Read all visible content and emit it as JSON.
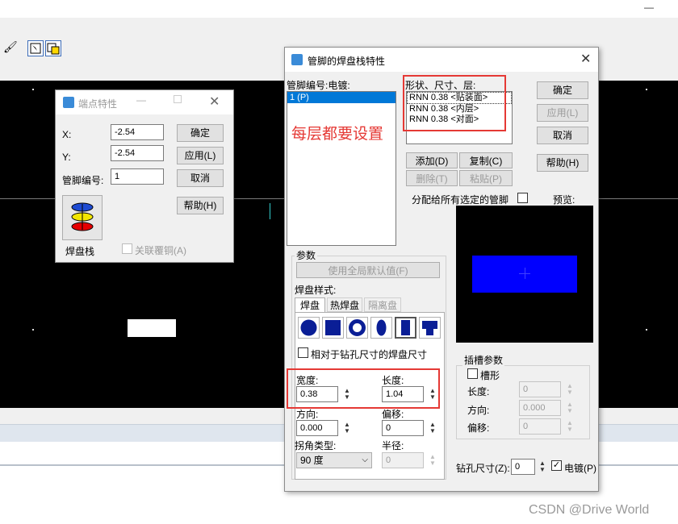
{
  "app": {
    "window_min_glyph": "—",
    "watermark": "CSDN @Drive World"
  },
  "vertex_dialog": {
    "title": "端点特性",
    "x_label": "X:",
    "x_value": "-2.54",
    "y_label": "Y:",
    "y_value": "-2.54",
    "pin_label": "管脚编号:",
    "pin_value": "1",
    "ok": "确定",
    "apply": "应用(L)",
    "cancel": "取消",
    "help": "帮助(H)",
    "padstack_label": "焊盘栈",
    "associate_copper": "关联覆铜(A)"
  },
  "pad_dialog": {
    "title": "管脚的焊盘栈特性",
    "pin_list_header": "管脚编号:电镀:",
    "pin_list_items": [
      "1 (P)"
    ],
    "layers_header": "形状、尺寸、层:",
    "layers": [
      "RNN 0.38 <贴装面>",
      "RNN 0.38 <内层>",
      "RNN 0.38 <对面>"
    ],
    "annotation": "每层都要设置",
    "ok": "确定",
    "apply": "应用(L)",
    "cancel": "取消",
    "help": "帮助(H)",
    "add": "添加(D)",
    "copy": "复制(C)",
    "delete": "删除(T)",
    "paste": "粘贴(P)",
    "assign_all": "分配给所有选定的管脚",
    "preview_label": "预览:",
    "params_title": "参数",
    "use_global": "使用全局默认值(F)",
    "pad_style_label": "焊盘样式:",
    "tabs": [
      "焊盘",
      "热焊盘",
      "隔离盘"
    ],
    "relative_to_drill": "相对于钻孔尺寸的焊盘尺寸",
    "width_label": "宽度:",
    "width_value": "0.38",
    "length_label": "长度:",
    "length_value": "1.04",
    "direction_label": "方向:",
    "direction_value": "0.000",
    "offset_label": "偏移:",
    "offset_value": "0",
    "corner_label": "拐角类型:",
    "corner_value": "90 度",
    "radius_label": "半径:",
    "radius_value": "0",
    "slot_title": "插槽参数",
    "slot_check": "槽形",
    "slot_length_label": "长度:",
    "slot_length_value": "0",
    "slot_direction_label": "方向:",
    "slot_direction_value": "0.000",
    "slot_offset_label": "偏移:",
    "slot_offset_value": "0",
    "drill_label": "钻孔尺寸(Z):",
    "drill_value": "0",
    "plated_label": "电镀(P)"
  },
  "colors": {
    "canvas": "#000000",
    "preview_pad": "#0000ff",
    "highlight": "#e53935",
    "selection": "#0078d7"
  }
}
